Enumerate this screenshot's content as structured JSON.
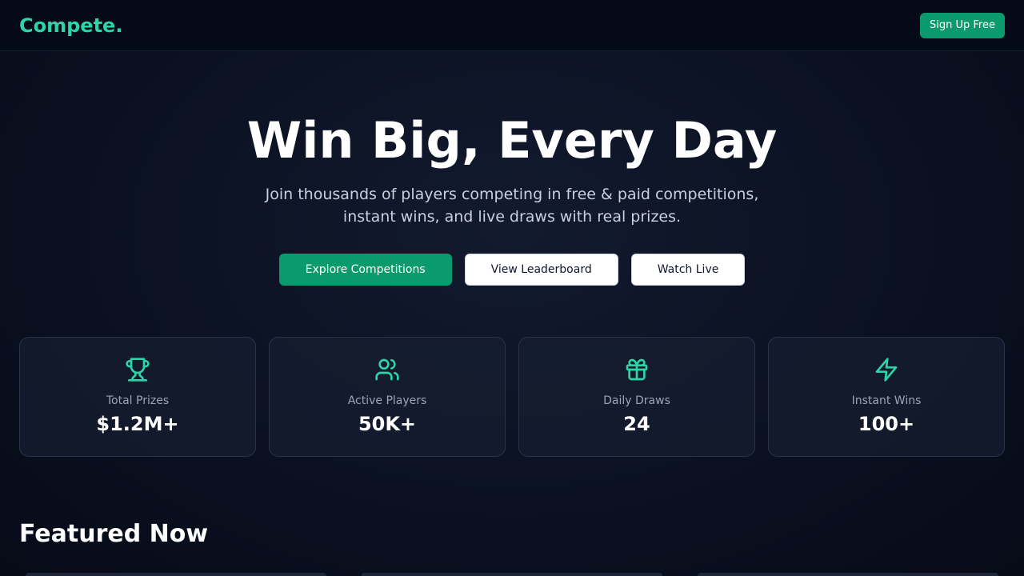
{
  "brand": {
    "name": "Compete.",
    "accent_color": "#2dd4a8",
    "primary_color": "#0b9a6b"
  },
  "navbar": {
    "signup_label": "Sign Up Free"
  },
  "hero": {
    "title": "Win Big, Every Day",
    "subtitle_line1": "Join thousands of players competing in free & paid competitions,",
    "subtitle_line2": "instant wins, and live draws with real prizes.",
    "buttons": [
      {
        "label": "Explore Competitions"
      },
      {
        "label": "View Leaderboard"
      },
      {
        "label": "Watch Live"
      }
    ]
  },
  "stats": [
    {
      "icon": "trophy-icon",
      "label": "Total Prizes",
      "value": "$1.2M+"
    },
    {
      "icon": "users-icon",
      "label": "Active Players",
      "value": "50K+"
    },
    {
      "icon": "gift-icon",
      "label": "Daily Draws",
      "value": "24"
    },
    {
      "icon": "lightning-icon",
      "label": "Instant Wins",
      "value": "100+"
    }
  ],
  "featured": {
    "title": "Featured Now"
  }
}
